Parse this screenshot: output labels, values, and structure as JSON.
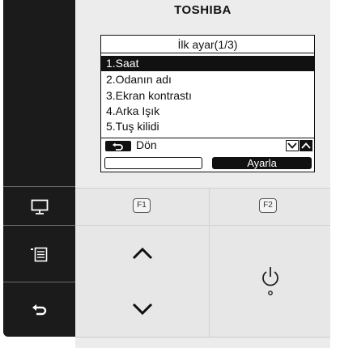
{
  "brand": "TOSHIBA",
  "screen": {
    "title": "İlk ayar(1/3)",
    "menu": [
      {
        "label": "1.Saat",
        "selected": true
      },
      {
        "label": "2.Odanın adı",
        "selected": false
      },
      {
        "label": "3.Ekran kontrastı",
        "selected": false
      },
      {
        "label": "4.Arka Işık",
        "selected": false
      },
      {
        "label": "5.Tuş kilidi",
        "selected": false
      }
    ],
    "back_label": "Dön",
    "f1_label": "",
    "f2_label": "Ayarla"
  },
  "keys": {
    "f1": "F1",
    "f2": "F2"
  },
  "icons": {
    "rail": [
      "monitor-icon",
      "menu-list-icon",
      "back-arrow-icon"
    ],
    "center": [
      "chevron-up-icon",
      "chevron-down-icon",
      "power-icon"
    ]
  },
  "colors": {
    "rail": "#1b1b1b",
    "panel": "#ececec",
    "lcd": "#ffffff",
    "ink": "#111111"
  }
}
